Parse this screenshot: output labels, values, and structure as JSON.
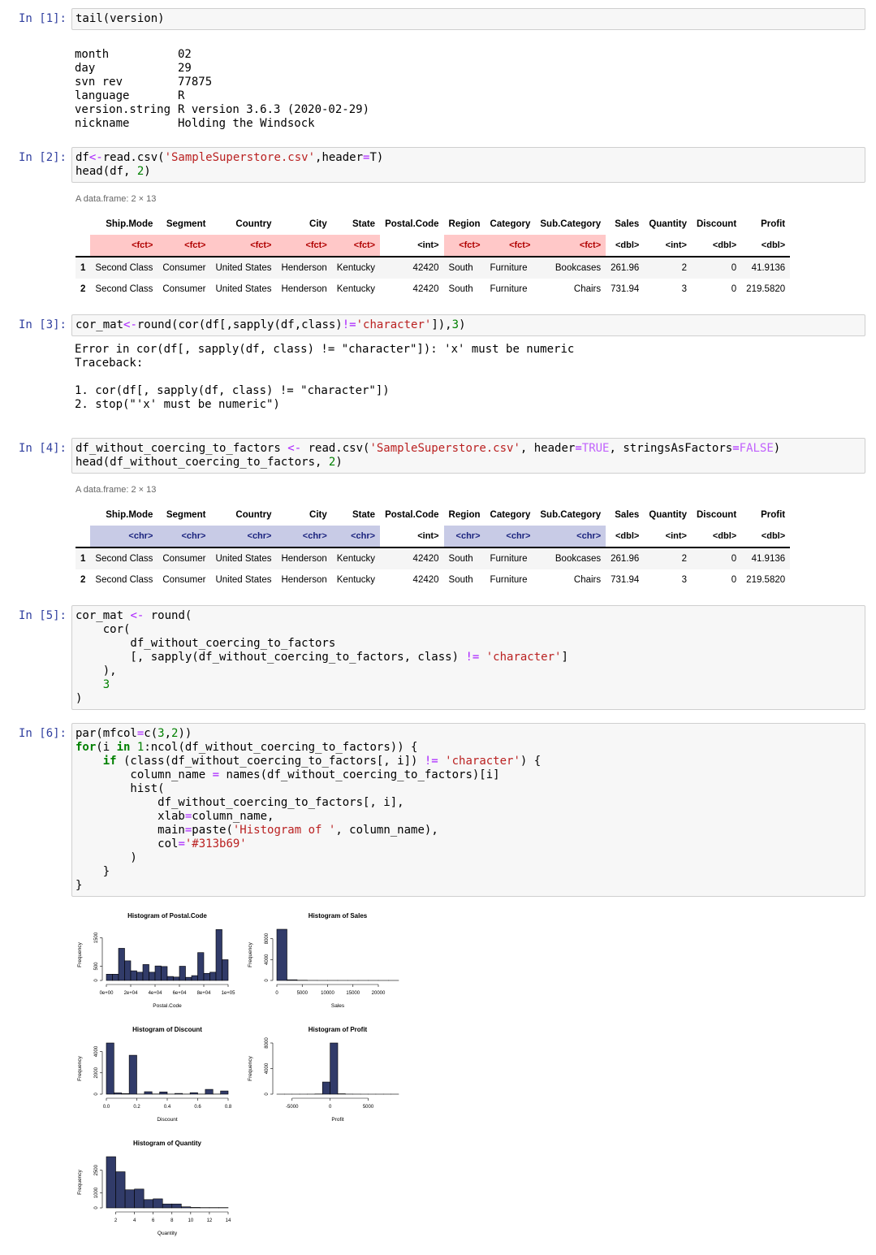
{
  "cells": [
    {
      "prompt": "In [1]:",
      "code": [
        [
          [
            "tail(version)",
            ""
          ]
        ]
      ],
      "output": [
        [
          "month",
          "02"
        ],
        [
          "day",
          "29"
        ],
        [
          "svn rev",
          "77875"
        ],
        [
          "language",
          "R"
        ],
        [
          "version.string",
          "R version 3.6.3 (2020-02-29)"
        ],
        [
          "nickname",
          "Holding the Windsock"
        ]
      ]
    },
    {
      "prompt": "In [2]:",
      "code": [
        [
          [
            "df",
            ""
          ],
          [
            "<-",
            "o"
          ],
          [
            "read.csv(",
            ""
          ],
          [
            "'SampleSuperstore.csv'",
            "s"
          ],
          [
            ",header",
            ""
          ],
          [
            "=",
            "o"
          ],
          [
            "T)",
            ""
          ]
        ],
        [
          [
            "head(df, ",
            ""
          ],
          [
            "2",
            "n"
          ],
          [
            ")",
            ""
          ]
        ]
      ]
    },
    {
      "prompt": "In [3]:",
      "code": [
        [
          [
            "cor_mat",
            ""
          ],
          [
            "<-",
            "o"
          ],
          [
            "round(cor(df[,sapply(df,class)",
            ""
          ],
          [
            "!=",
            "o"
          ],
          [
            "'character'",
            "s"
          ],
          [
            "]),",
            ""
          ],
          [
            "3",
            "n"
          ],
          [
            ")",
            ""
          ]
        ]
      ],
      "error": [
        "Error in cor(df[, sapply(df, class) != \"character\"]): 'x' must be numeric",
        "Traceback:",
        "",
        "1. cor(df[, sapply(df, class) != \"character\"])",
        "2. stop(\"'x' must be numeric\")"
      ]
    },
    {
      "prompt": "In [4]:",
      "code": [
        [
          [
            "df_without_coercing_to_factors ",
            ""
          ],
          [
            "<-",
            "o"
          ],
          [
            " read.csv(",
            ""
          ],
          [
            "'SampleSuperstore.csv'",
            "s"
          ],
          [
            ", header",
            ""
          ],
          [
            "=",
            "o"
          ],
          [
            "TRUE",
            "c"
          ],
          [
            ", stringsAsFactors",
            ""
          ],
          [
            "=",
            "o"
          ],
          [
            "FALSE",
            "c"
          ],
          [
            ")",
            ""
          ]
        ],
        [
          [
            "head(df_without_coercing_to_factors, ",
            ""
          ],
          [
            "2",
            "n"
          ],
          [
            ")",
            ""
          ]
        ]
      ]
    },
    {
      "prompt": "In [5]:",
      "code": [
        [
          [
            "cor_mat ",
            ""
          ],
          [
            "<-",
            "o"
          ],
          [
            " round(",
            ""
          ]
        ],
        [
          [
            "    cor(",
            ""
          ]
        ],
        [
          [
            "        df_without_coercing_to_factors",
            ""
          ]
        ],
        [
          [
            "        [, sapply(df_without_coercing_to_factors, class) ",
            ""
          ],
          [
            "!=",
            "o"
          ],
          [
            " ",
            ""
          ],
          [
            "'character'",
            "s"
          ],
          [
            "]",
            ""
          ]
        ],
        [
          [
            "    ),",
            ""
          ]
        ],
        [
          [
            "    ",
            ""
          ],
          [
            "3",
            "n"
          ]
        ],
        [
          [
            ")",
            ""
          ]
        ]
      ]
    },
    {
      "prompt": "In [6]:",
      "code": [
        [
          [
            "par(mfcol",
            ""
          ],
          [
            "=",
            "o"
          ],
          [
            "c(",
            ""
          ],
          [
            "3",
            "n"
          ],
          [
            ",",
            ""
          ],
          [
            "2",
            "n"
          ],
          [
            "))",
            ""
          ]
        ],
        [
          [
            "for",
            "k"
          ],
          [
            "(i ",
            ""
          ],
          [
            "in",
            "k"
          ],
          [
            " ",
            ""
          ],
          [
            "1",
            "n"
          ],
          [
            ":ncol(df_without_coercing_to_factors)) {",
            ""
          ]
        ],
        [
          [
            "    ",
            ""
          ],
          [
            "if",
            "k"
          ],
          [
            " (class(df_without_coercing_to_factors[, i]) ",
            ""
          ],
          [
            "!=",
            "o"
          ],
          [
            " ",
            ""
          ],
          [
            "'character'",
            "s"
          ],
          [
            ") {",
            ""
          ]
        ],
        [
          [
            "        column_name ",
            ""
          ],
          [
            "=",
            "o"
          ],
          [
            " names(df_without_coercing_to_factors)[i]",
            ""
          ]
        ],
        [
          [
            "        hist(",
            ""
          ]
        ],
        [
          [
            "            df_without_coercing_to_factors[, i],",
            ""
          ]
        ],
        [
          [
            "            xlab",
            ""
          ],
          [
            "=",
            "o"
          ],
          [
            "column_name,",
            ""
          ]
        ],
        [
          [
            "            main",
            ""
          ],
          [
            "=",
            "o"
          ],
          [
            "paste(",
            ""
          ],
          [
            "'Histogram of '",
            "s"
          ],
          [
            ", column_name),",
            ""
          ]
        ],
        [
          [
            "            col",
            ""
          ],
          [
            "=",
            "o"
          ],
          [
            "'#313b69'",
            "s"
          ]
        ],
        [
          [
            "        )",
            ""
          ]
        ],
        [
          [
            "    }",
            ""
          ]
        ],
        [
          [
            "}",
            ""
          ]
        ]
      ]
    }
  ],
  "tables": [
    {
      "caption": "A data.frame: 2 × 13",
      "columns": [
        "Ship.Mode",
        "Segment",
        "Country",
        "City",
        "State",
        "Postal.Code",
        "Region",
        "Category",
        "Sub.Category",
        "Sales",
        "Quantity",
        "Discount",
        "Profit"
      ],
      "types": [
        "<fct>",
        "<fct>",
        "<fct>",
        "<fct>",
        "<fct>",
        "<int>",
        "<fct>",
        "<fct>",
        "<fct>",
        "<dbl>",
        "<int>",
        "<dbl>",
        "<dbl>"
      ],
      "rows": [
        [
          "1",
          "Second Class",
          "Consumer",
          "United States",
          "Henderson",
          "Kentucky",
          "42420",
          "South",
          "Furniture",
          "Bookcases",
          "261.96",
          "2",
          "0",
          "41.9136"
        ],
        [
          "2",
          "Second Class",
          "Consumer",
          "United States",
          "Henderson",
          "Kentucky",
          "42420",
          "South",
          "Furniture",
          "Chairs",
          "731.94",
          "3",
          "0",
          "219.5820"
        ]
      ]
    },
    {
      "caption": "A data.frame: 2 × 13",
      "columns": [
        "Ship.Mode",
        "Segment",
        "Country",
        "City",
        "State",
        "Postal.Code",
        "Region",
        "Category",
        "Sub.Category",
        "Sales",
        "Quantity",
        "Discount",
        "Profit"
      ],
      "types": [
        "<chr>",
        "<chr>",
        "<chr>",
        "<chr>",
        "<chr>",
        "<int>",
        "<chr>",
        "<chr>",
        "<chr>",
        "<dbl>",
        "<int>",
        "<dbl>",
        "<dbl>"
      ],
      "rows": [
        [
          "1",
          "Second Class",
          "Consumer",
          "United States",
          "Henderson",
          "Kentucky",
          "42420",
          "South",
          "Furniture",
          "Bookcases",
          "261.96",
          "2",
          "0",
          "41.9136"
        ],
        [
          "2",
          "Second Class",
          "Consumer",
          "United States",
          "Henderson",
          "Kentucky",
          "42420",
          "South",
          "Furniture",
          "Chairs",
          "731.94",
          "3",
          "0",
          "219.5820"
        ]
      ]
    }
  ],
  "chart_data": [
    {
      "type": "bar",
      "title": "Histogram of  Postal.Code",
      "xlabel": "Postal.Code",
      "ylabel": "Frequency",
      "bar_color": "#313b69",
      "xlim": [
        0,
        100000
      ],
      "ylim": [
        0,
        1800
      ],
      "breaks_start": 0,
      "bin_width": 5000,
      "values": [
        220,
        220,
        1130,
        690,
        340,
        290,
        560,
        290,
        510,
        490,
        140,
        120,
        500,
        110,
        170,
        980,
        250,
        290,
        1790,
        730
      ],
      "xticks": [
        0,
        20000,
        40000,
        60000,
        80000,
        100000
      ],
      "xtick_labels": [
        "0e+00",
        "2e+04",
        "4e+04",
        "6e+04",
        "8e+04",
        "1e+05"
      ],
      "yticks": [
        0,
        500,
        1500
      ],
      "ytick_labels": [
        "0",
        "500",
        "1500"
      ]
    },
    {
      "type": "bar",
      "title": "Histogram of  Discount",
      "xlabel": "Discount",
      "ylabel": "Frequency",
      "bar_color": "#313b69",
      "xlim": [
        0,
        0.8
      ],
      "ylim": [
        0,
        4800
      ],
      "breaks_start": 0,
      "bin_width": 0.05,
      "values": [
        4800,
        120,
        50,
        3650,
        10,
        230,
        20,
        210,
        10,
        70,
        10,
        140,
        10,
        450,
        10,
        300
      ],
      "xticks": [
        0,
        0.2,
        0.4,
        0.6,
        0.8
      ],
      "xtick_labels": [
        "0.0",
        "0.2",
        "0.4",
        "0.6",
        "0.8"
      ],
      "yticks": [
        0,
        2000,
        4000
      ],
      "ytick_labels": [
        "0",
        "2000",
        "4000"
      ]
    },
    {
      "type": "bar",
      "title": "Histogram of  Sales",
      "xlabel": "Sales",
      "ylabel": "Frequency",
      "bar_color": "#313b69",
      "xlim": [
        0,
        24000
      ],
      "ylim": [
        0,
        9800
      ],
      "breaks_start": 0,
      "bin_width": 2000,
      "values": [
        9800,
        130,
        40,
        10,
        5,
        5,
        3,
        2,
        2,
        2,
        1,
        1
      ],
      "xticks": [
        0,
        5000,
        10000,
        15000,
        20000
      ],
      "xtick_labels": [
        "0",
        "5000",
        "10000",
        "15000",
        "20000"
      ],
      "yticks": [
        0,
        4000,
        8000
      ],
      "ytick_labels": [
        "0",
        "4000",
        "8000"
      ]
    },
    {
      "type": "bar",
      "title": "Histogram of  Profit",
      "xlabel": "Profit",
      "ylabel": "Frequency",
      "bar_color": "#313b69",
      "xlim": [
        -7000,
        9000
      ],
      "ylim": [
        0,
        8000
      ],
      "breaks_start": -7000,
      "bin_width": 1000,
      "values": [
        1,
        1,
        1,
        2,
        5,
        30,
        1900,
        8000,
        60,
        10,
        5,
        2,
        1,
        1,
        1,
        1
      ],
      "xticks": [
        -5000,
        0,
        5000
      ],
      "xtick_labels": [
        "-5000",
        "0",
        "5000"
      ],
      "yticks": [
        0,
        4000,
        8000
      ],
      "ytick_labels": [
        "0",
        "4000",
        "8000"
      ]
    },
    {
      "type": "bar",
      "title": "Histogram of  Quantity",
      "xlabel": "Quantity",
      "ylabel": "Frequency",
      "bar_color": "#313b69",
      "xlim": [
        1,
        14
      ],
      "ylim": [
        0,
        3400
      ],
      "breaks_start": 1,
      "bin_width": 1,
      "values": [
        3400,
        2400,
        1200,
        1250,
        550,
        600,
        260,
        260,
        70,
        30,
        20,
        20,
        20
      ],
      "xticks": [
        2,
        4,
        6,
        8,
        10,
        12,
        14
      ],
      "xtick_labels": [
        "2",
        "4",
        "6",
        "8",
        "10",
        "12",
        "14"
      ],
      "yticks": [
        0,
        1000,
        2500
      ],
      "ytick_labels": [
        "0",
        "1000",
        "2500"
      ]
    }
  ]
}
